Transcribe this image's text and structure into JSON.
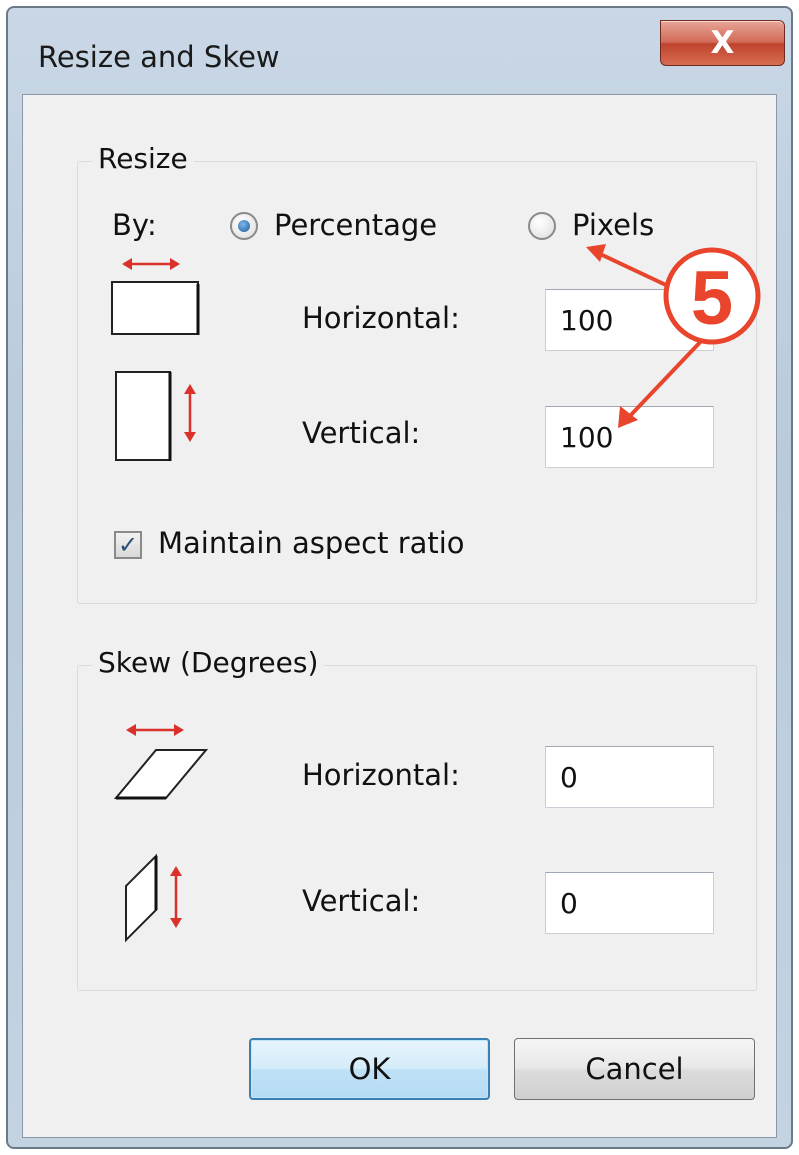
{
  "window": {
    "title": "Resize and Skew",
    "close_glyph": "X"
  },
  "resize": {
    "legend": "Resize",
    "by_label": "By:",
    "options": [
      {
        "label": "Percentage",
        "selected": true
      },
      {
        "label": "Pixels",
        "selected": false
      }
    ],
    "horizontal": {
      "label": "Horizontal:",
      "value": "100",
      "icon": "resize-horizontal-icon"
    },
    "vertical": {
      "label": "Vertical:",
      "value": "100",
      "icon": "resize-vertical-icon"
    },
    "maintain_aspect": {
      "label": "Maintain aspect ratio",
      "checked": true,
      "check_glyph": "✓"
    }
  },
  "skew": {
    "legend": "Skew (Degrees)",
    "horizontal": {
      "label": "Horizontal:",
      "value": "0",
      "icon": "skew-horizontal-icon"
    },
    "vertical": {
      "label": "Vertical:",
      "value": "0",
      "icon": "skew-vertical-icon"
    }
  },
  "buttons": {
    "ok": "OK",
    "cancel": "Cancel"
  },
  "annotation": {
    "number": "5",
    "color": "#e8452c"
  }
}
